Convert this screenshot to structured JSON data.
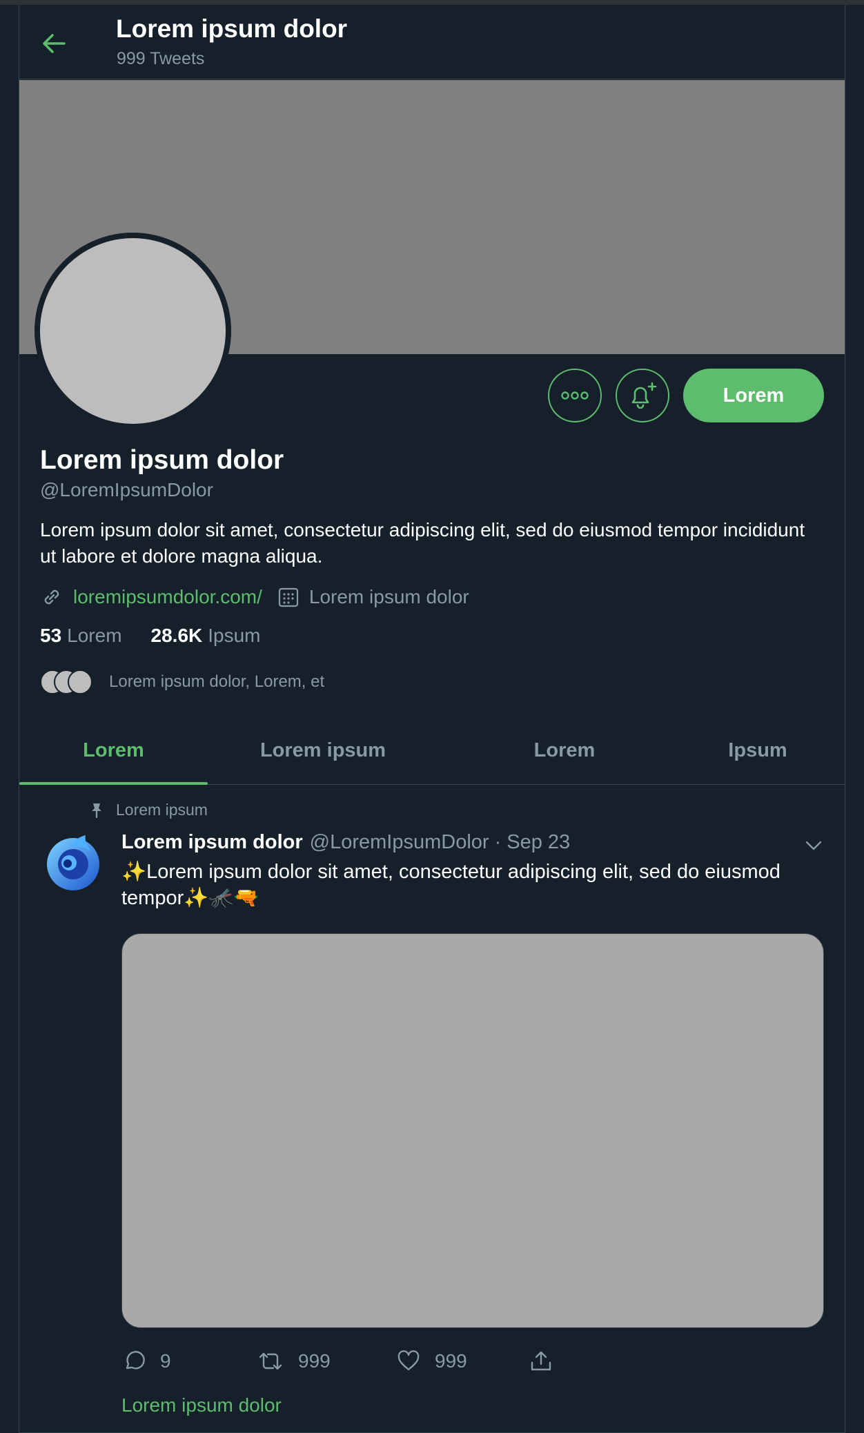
{
  "header": {
    "title": "Lorem ipsum dolor",
    "tweet_count": "999 Tweets"
  },
  "profile": {
    "name": "Lorem ipsum dolor",
    "handle": "@LoremIpsumDolor",
    "bio": "Lorem ipsum dolor sit amet, consectetur adipiscing elit, sed do eiusmod tempor incididunt ut labore et dolore magna aliqua.",
    "website": "loremipsumdolor.com/",
    "joined": "Lorem ipsum dolor",
    "follow_label": "Lorem",
    "following": {
      "count": "53",
      "label": "Lorem"
    },
    "followers": {
      "count": "28.6K",
      "label": "Ipsum"
    },
    "followed_by": "Lorem ipsum dolor, Lorem, et"
  },
  "tabs": [
    {
      "label": "Lorem",
      "active": true
    },
    {
      "label": "Lorem ipsum",
      "active": false
    },
    {
      "label": "Lorem",
      "active": false
    },
    {
      "label": "Ipsum",
      "active": false
    }
  ],
  "tweet": {
    "pinned_label": "Lorem ipsum",
    "author_name": "Lorem ipsum dolor",
    "author_handle": "@LoremIpsumDolor",
    "separator": "·",
    "date": "Sep 23",
    "text": "✨Lorem ipsum dolor sit amet, consectetur adipiscing elit, sed do eiusmod tempor✨🦟🔫",
    "replies": "9",
    "retweets": "999",
    "likes": "999",
    "show_thread": "Lorem ipsum dolor"
  },
  "colors": {
    "background": "#15202b",
    "accent": "#5ebd6c",
    "secondary_text": "#8b98a5",
    "border": "#38444d"
  }
}
